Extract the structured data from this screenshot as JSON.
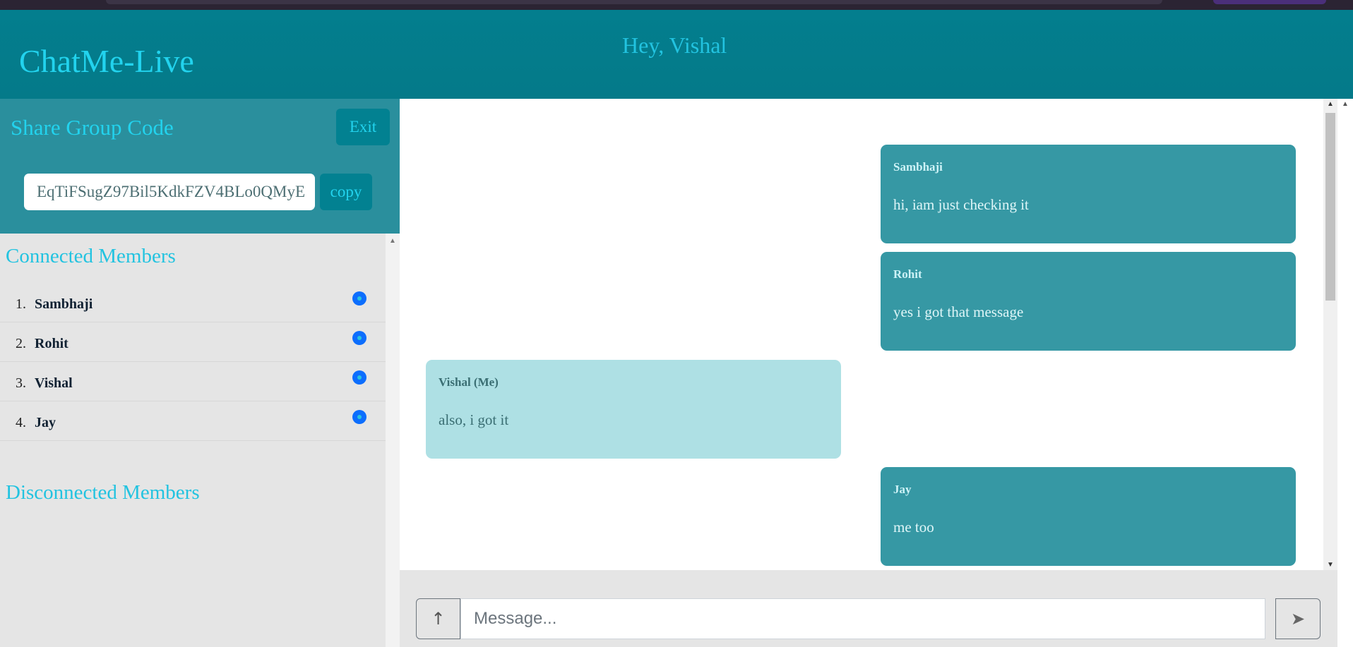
{
  "header": {
    "brand": "ChatMe-Live",
    "greeting": "Hey, Vishal"
  },
  "share": {
    "title": "Share Group Code",
    "exit_label": "Exit",
    "code_value": "EqTiFSugZ97Bil5KdkFZV4BLo0QMyE",
    "copy_label": "copy"
  },
  "members": {
    "connected_title": "Connected Members",
    "disconnected_title": "Disconnected Members",
    "connected": [
      {
        "num": "1.",
        "name": "Sambhaji"
      },
      {
        "num": "2.",
        "name": "Rohit"
      },
      {
        "num": "3.",
        "name": "Vishal"
      },
      {
        "num": "4.",
        "name": "Jay"
      }
    ]
  },
  "messages": [
    {
      "author": "Sambhaji",
      "text": "hi, iam just checking it",
      "mine": false
    },
    {
      "author": "Rohit",
      "text": "yes i got that message",
      "mine": false
    },
    {
      "author": "Vishal (Me)",
      "text": "also, i got it",
      "mine": true
    },
    {
      "author": "Jay",
      "text": "me too",
      "mine": false
    }
  ],
  "composer": {
    "attach_icon": "↑",
    "placeholder": "Message...",
    "send_icon": "➤"
  },
  "icons": {
    "online_status": "online-dot-icon",
    "attach": "arrow-up-icon",
    "send": "send-arrow-icon"
  },
  "colors": {
    "header": "#037e8e",
    "accent_text": "#22d3ee",
    "others_bubble": "#3698a4",
    "my_bubble": "#aee0e4",
    "online_dot": "#0d6efd"
  }
}
